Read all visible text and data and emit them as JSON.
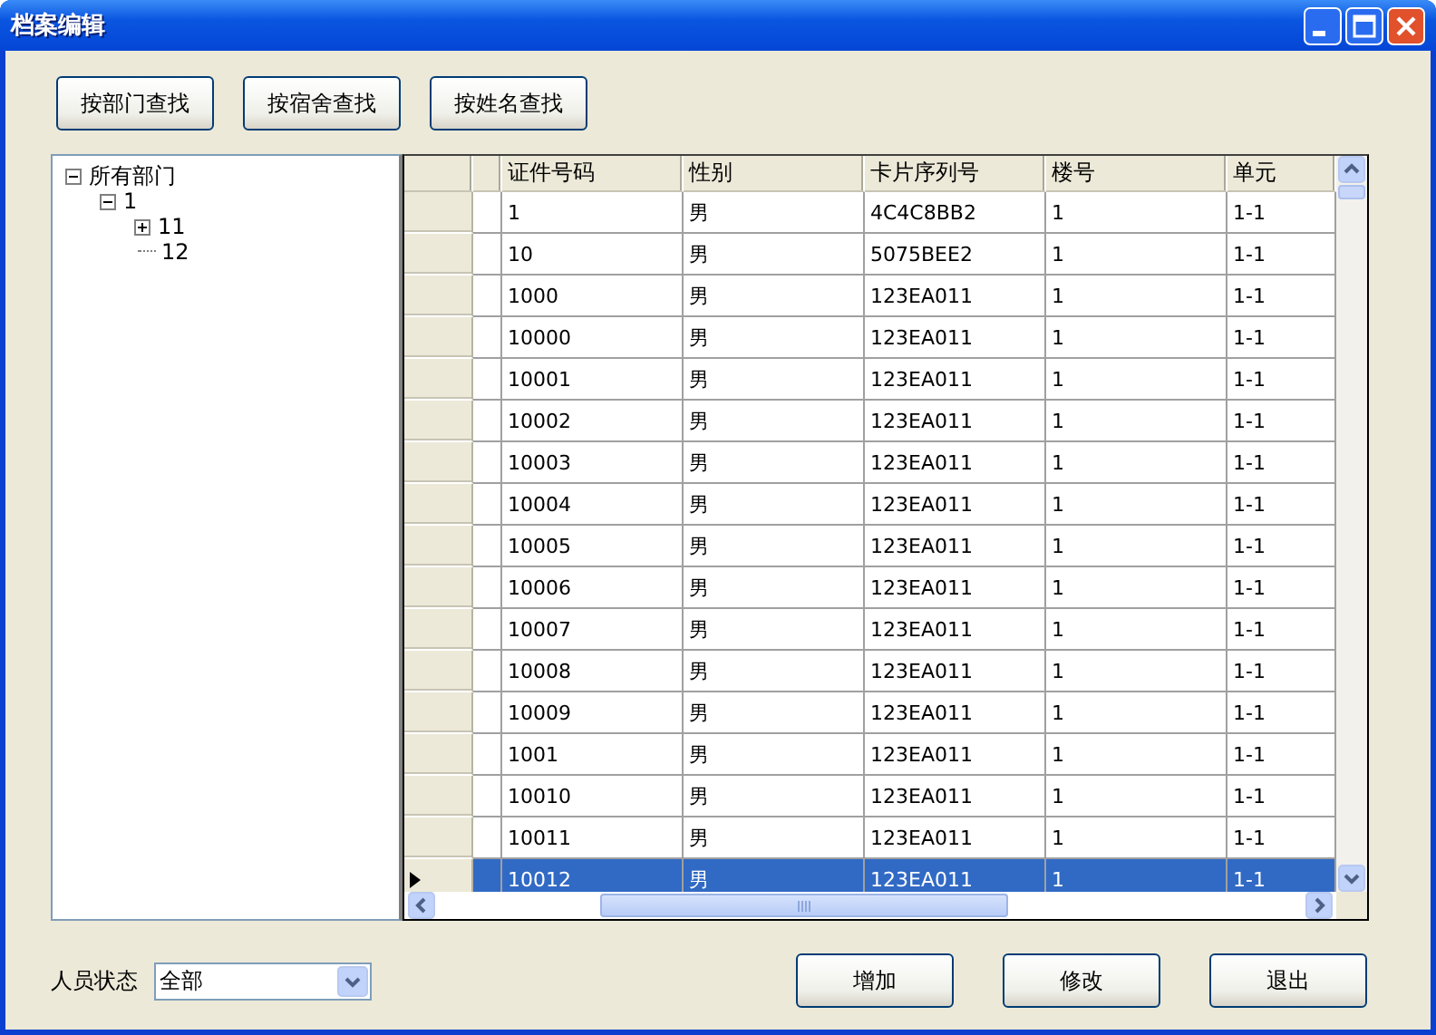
{
  "window": {
    "title": "档案编辑"
  },
  "search_buttons": [
    "按部门查找",
    "按宿舍查找",
    "按姓名查找"
  ],
  "tree": [
    {
      "label": "所有部门",
      "expanded": true,
      "children": [
        {
          "label": "1",
          "expanded": true,
          "children": [
            {
              "label": "11",
              "expanded": false
            },
            {
              "label": "12"
            }
          ]
        }
      ]
    }
  ],
  "table": {
    "columns": [
      "证件号码",
      "性别",
      "卡片序列号",
      "楼号",
      "单元"
    ],
    "rows": [
      {
        "cells": [
          "1",
          "男",
          "4C4C8BB2",
          "1",
          "1-1"
        ],
        "selected": false
      },
      {
        "cells": [
          "10",
          "男",
          "5075BEE2",
          "1",
          "1-1"
        ],
        "selected": false
      },
      {
        "cells": [
          "1000",
          "男",
          "123EA011",
          "1",
          "1-1"
        ],
        "selected": false
      },
      {
        "cells": [
          "10000",
          "男",
          "123EA011",
          "1",
          "1-1"
        ],
        "selected": false
      },
      {
        "cells": [
          "10001",
          "男",
          "123EA011",
          "1",
          "1-1"
        ],
        "selected": false
      },
      {
        "cells": [
          "10002",
          "男",
          "123EA011",
          "1",
          "1-1"
        ],
        "selected": false
      },
      {
        "cells": [
          "10003",
          "男",
          "123EA011",
          "1",
          "1-1"
        ],
        "selected": false
      },
      {
        "cells": [
          "10004",
          "男",
          "123EA011",
          "1",
          "1-1"
        ],
        "selected": false
      },
      {
        "cells": [
          "10005",
          "男",
          "123EA011",
          "1",
          "1-1"
        ],
        "selected": false
      },
      {
        "cells": [
          "10006",
          "男",
          "123EA011",
          "1",
          "1-1"
        ],
        "selected": false
      },
      {
        "cells": [
          "10007",
          "男",
          "123EA011",
          "1",
          "1-1"
        ],
        "selected": false
      },
      {
        "cells": [
          "10008",
          "男",
          "123EA011",
          "1",
          "1-1"
        ],
        "selected": false
      },
      {
        "cells": [
          "10009",
          "男",
          "123EA011",
          "1",
          "1-1"
        ],
        "selected": false
      },
      {
        "cells": [
          "1001",
          "男",
          "123EA011",
          "1",
          "1-1"
        ],
        "selected": false
      },
      {
        "cells": [
          "10010",
          "男",
          "123EA011",
          "1",
          "1-1"
        ],
        "selected": false
      },
      {
        "cells": [
          "10011",
          "男",
          "123EA011",
          "1",
          "1-1"
        ],
        "selected": false
      },
      {
        "cells": [
          "10012",
          "男",
          "123EA011",
          "1",
          "1-1"
        ],
        "selected": true
      }
    ]
  },
  "status_filter": {
    "label": "人员状态",
    "value": "全部"
  },
  "buttons": [
    "增加",
    "修改",
    "退出"
  ]
}
